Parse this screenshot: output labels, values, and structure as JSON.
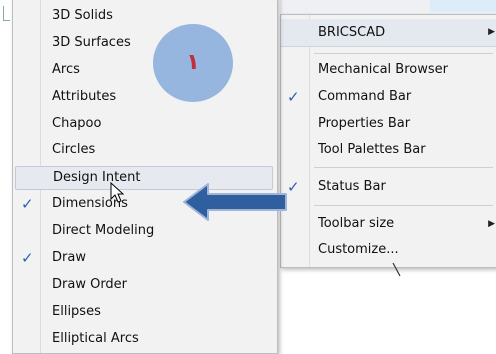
{
  "left_menu": {
    "items": [
      {
        "label": "3D Solids",
        "checked": false
      },
      {
        "label": "3D Surfaces",
        "checked": false
      },
      {
        "label": "Arcs",
        "checked": false
      },
      {
        "label": "Attributes",
        "checked": false
      },
      {
        "label": "Chapoo",
        "checked": false
      },
      {
        "label": "Circles",
        "checked": false
      },
      {
        "label": "Design Intent",
        "checked": false,
        "hover": true
      },
      {
        "label": "Dimensions",
        "checked": true
      },
      {
        "label": "Direct Modeling",
        "checked": false
      },
      {
        "label": "Draw",
        "checked": true
      },
      {
        "label": "Draw Order",
        "checked": false
      },
      {
        "label": "Ellipses",
        "checked": false
      },
      {
        "label": "Elliptical Arcs",
        "checked": false
      }
    ]
  },
  "right_menu": {
    "top_item": {
      "label": "BRICSCAD",
      "has_submenu": true
    },
    "items": [
      {
        "label": "Mechanical Browser",
        "checked": false
      },
      {
        "label": "Command Bar",
        "checked": true
      },
      {
        "label": "Properties Bar",
        "checked": false
      },
      {
        "label": "Tool Palettes Bar",
        "checked": false
      },
      {
        "label": "Status Bar",
        "checked": true
      },
      {
        "label": "Toolbar size",
        "checked": false,
        "has_submenu": true
      },
      {
        "label": "Customize...",
        "checked": false
      }
    ]
  },
  "annotation": {
    "badge_text": "١",
    "badge_color": "#8fb1de",
    "arrow_color": "#2f5f9e"
  },
  "icons": {
    "check": "✓",
    "submenu": "▶"
  }
}
